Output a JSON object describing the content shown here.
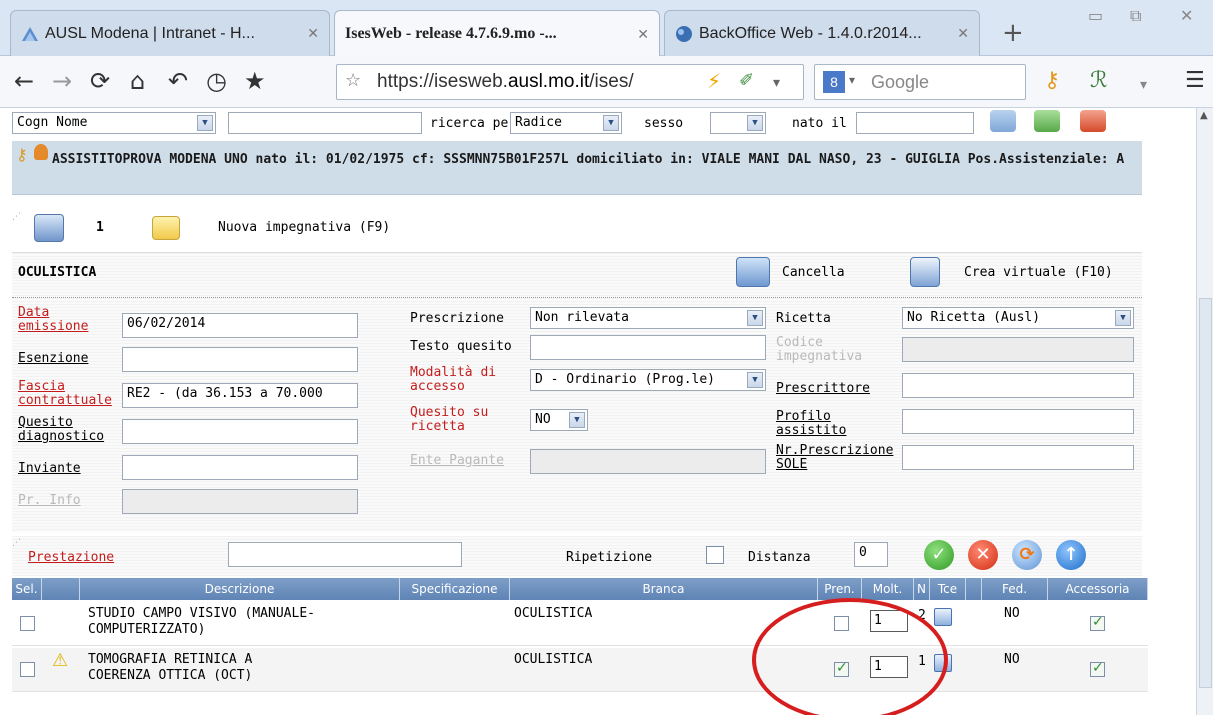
{
  "browser": {
    "tabs": [
      {
        "label": "AUSL Modena | Intranet - H...",
        "close": "✕"
      },
      {
        "label": "IsesWeb - release 4.7.6.9.mo -...",
        "close": "✕"
      },
      {
        "label": "BackOffice Web - 1.4.0.r2014...",
        "close": "✕"
      }
    ],
    "new_tab": "+",
    "url_prefix": "https://isesweb.",
    "url_domain": "ausl.mo.it",
    "url_suffix": "/ises/",
    "search_placeholder": "Google",
    "search_engine_badge": "8"
  },
  "search": {
    "field_select": "Cogn Nome",
    "ricerca_label": "ricerca per",
    "ricerca_value": "Radice",
    "sesso_label": "sesso",
    "nato_label": "nato il"
  },
  "patient": {
    "banner": "ASSISTITOPROVA MODENA UNO nato il: 01/02/1975  cf: SSSMNN75B01F257L  domiciliato in: VIALE MANI DAL NASO, 23 - GUIGLIA Pos.Assistenziale: A"
  },
  "tabs": {
    "count": "1",
    "new_label": "Nuova impegnativa (F9)"
  },
  "form": {
    "title": "OCULISTICA",
    "cancel": "Cancella",
    "create_virtual": "Crea virtuale (F10)",
    "data_emissione_label_1": "Data",
    "data_emissione_label_2": "emissione",
    "data_emissione": "06/02/2014",
    "esenzione_label": "Esenzione",
    "fascia_label_1": "Fascia",
    "fascia_label_2": "contrattuale",
    "fascia_value": "RE2 - (da 36.153 a 70.000",
    "quesito_label_1": "Quesito",
    "quesito_label_2": "diagnostico",
    "inviante_label": "Inviante",
    "pr_info_label": "Pr. Info",
    "prescrizione_label": "Prescrizione",
    "prescrizione_value": "Non rilevata",
    "testo_quesito_label": "Testo quesito",
    "modalita_label_1": "Modalità di",
    "modalita_label_2": "accesso",
    "modalita_value": "D - Ordinario (Prog.le)",
    "quesito_ricetta_label_1": "Quesito su",
    "quesito_ricetta_label_2": "ricetta",
    "quesito_ricetta_value": "NO",
    "ente_pagante_label": "Ente Pagante",
    "ricetta_label": "Ricetta",
    "ricetta_value": "No Ricetta (Ausl)",
    "codice_label_1": "Codice",
    "codice_label_2": "impegnativa",
    "prescrittore_label": "Prescrittore",
    "profilo_label_1": "Profilo",
    "profilo_label_2": "assistito",
    "nr_prescrizione_label_1": "Nr.Prescrizione",
    "nr_prescrizione_label_2": "SOLE"
  },
  "prestazione": {
    "label": "Prestazione",
    "ripetizione_label": "Ripetizione",
    "distanza_label": "Distanza",
    "distanza_value": "0"
  },
  "grid": {
    "columns": [
      "Sel.",
      "",
      "Descrizione",
      "Specificazione",
      "Branca",
      "Pren.",
      "Molt.",
      "N",
      "Tce",
      "",
      "Fed.",
      "Accessoria"
    ],
    "rows": [
      {
        "desc_1": "STUDIO CAMPO VISIVO (MANUALE-",
        "desc_2": "COMPUTERIZZATO)",
        "branca": "OCULISTICA",
        "pren": false,
        "molt": "1",
        "n": "2",
        "fed": "NO",
        "accessoria": true,
        "warning": false
      },
      {
        "desc_1": "TOMOGRAFIA RETINICA A",
        "desc_2": "COERENZA OTTICA (OCT)",
        "branca": "OCULISTICA",
        "pren": true,
        "molt": "1",
        "n": "1",
        "fed": "NO",
        "accessoria": true,
        "warning": true
      }
    ]
  },
  "colors": {
    "accent": "#5f84b5",
    "banner": "#cfdde9",
    "required_label": "#c41c1c",
    "annotation_ring": "#d61e1e"
  }
}
